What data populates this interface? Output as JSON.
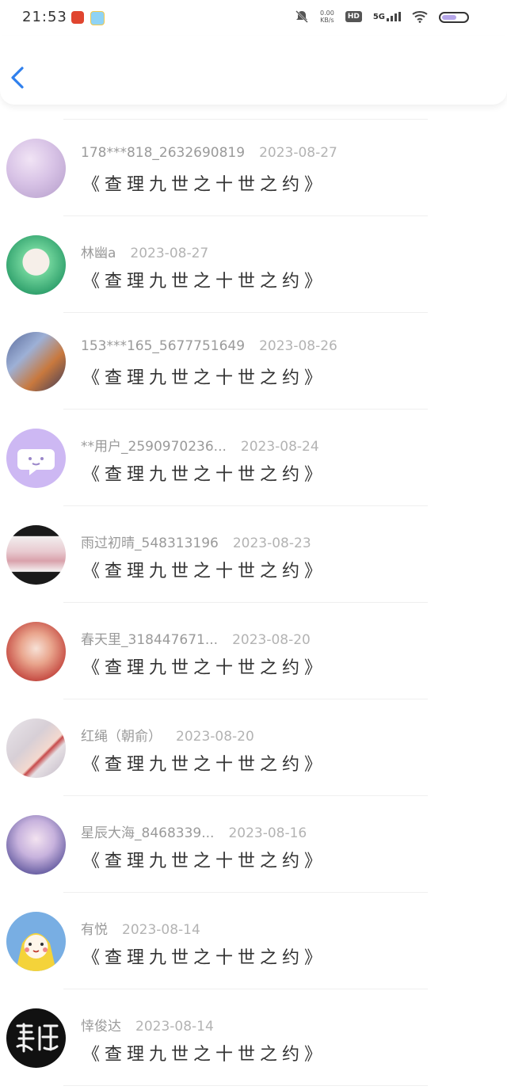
{
  "status": {
    "time": "21:53",
    "speed_value": "0.00",
    "speed_unit": "KB/s",
    "hd": "HD",
    "network": "5G"
  },
  "header": {
    "back_icon": "chevron-left-icon",
    "accent": "#2f80ed"
  },
  "rows": [
    {
      "user": "178***818_2632690819",
      "date": "2023-08-27",
      "title": "《查理九世之十世之约》"
    },
    {
      "user": "林幽a",
      "date": "2023-08-27",
      "title": "《查理九世之十世之约》"
    },
    {
      "user": "153***165_5677751649",
      "date": "2023-08-26",
      "title": "《查理九世之十世之约》"
    },
    {
      "user": "**用户_2590970236...",
      "date": "2023-08-24",
      "title": "《查理九世之十世之约》"
    },
    {
      "user": "雨过初晴_548313196",
      "date": "2023-08-23",
      "title": "《查理九世之十世之约》"
    },
    {
      "user": "春天里_318447671...",
      "date": "2023-08-20",
      "title": "《查理九世之十世之约》"
    },
    {
      "user": "红绳（朝俞）",
      "date": "2023-08-20",
      "title": "《查理九世之十世之约》"
    },
    {
      "user": "星辰大海_8468339...",
      "date": "2023-08-16",
      "title": "《查理九世之十世之约》"
    },
    {
      "user": "有悦",
      "date": "2023-08-14",
      "title": "《查理九世之十世之约》"
    },
    {
      "user": "悻俊达",
      "date": "2023-08-14",
      "title": "《查理九世之十世之约》"
    }
  ]
}
